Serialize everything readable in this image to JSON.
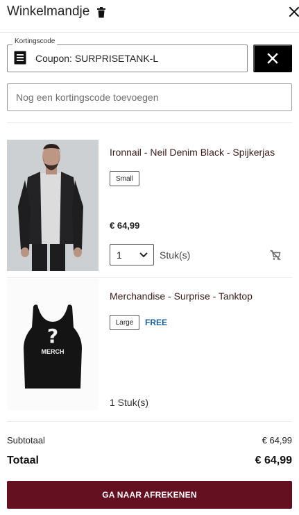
{
  "header": {
    "title": "Winkelmandje",
    "trash_icon": "trash-icon",
    "close_icon": "close-icon"
  },
  "coupon": {
    "legend": "Kortingscode",
    "icon": "receipt-icon",
    "value": "Coupon: SURPRISETANK-L",
    "remove_icon": "close-icon"
  },
  "code_input": {
    "placeholder": "Nog een kortingscode toevoegen",
    "value": ""
  },
  "items": [
    {
      "image": "denim-jacket-model-photo",
      "name": "Ironnail - Neil Denim Black - Spijkerjas",
      "size": "Small",
      "price": "€ 64,99",
      "quantity": "1",
      "unit": "Stuk(s)",
      "remove_icon": "remove-from-cart-icon"
    },
    {
      "image": "tanktop-merch-photo",
      "image_text": "MERCH",
      "name": "Merchandise - Surprise - Tanktop",
      "size": "Large",
      "badge": "FREE",
      "quantity_text": "1 Stuk(s)"
    }
  ],
  "totals": {
    "subtotal_label": "Subtotaal",
    "subtotal_value": "€ 64,99",
    "total_label": "Totaal",
    "total_value": "€ 64,99"
  },
  "checkout": {
    "label": "GA NAAR AFREKENEN"
  },
  "colors": {
    "checkout_bg": "#651021",
    "free_badge": "#1a5e9a",
    "product_name": "#3a1a1a"
  }
}
